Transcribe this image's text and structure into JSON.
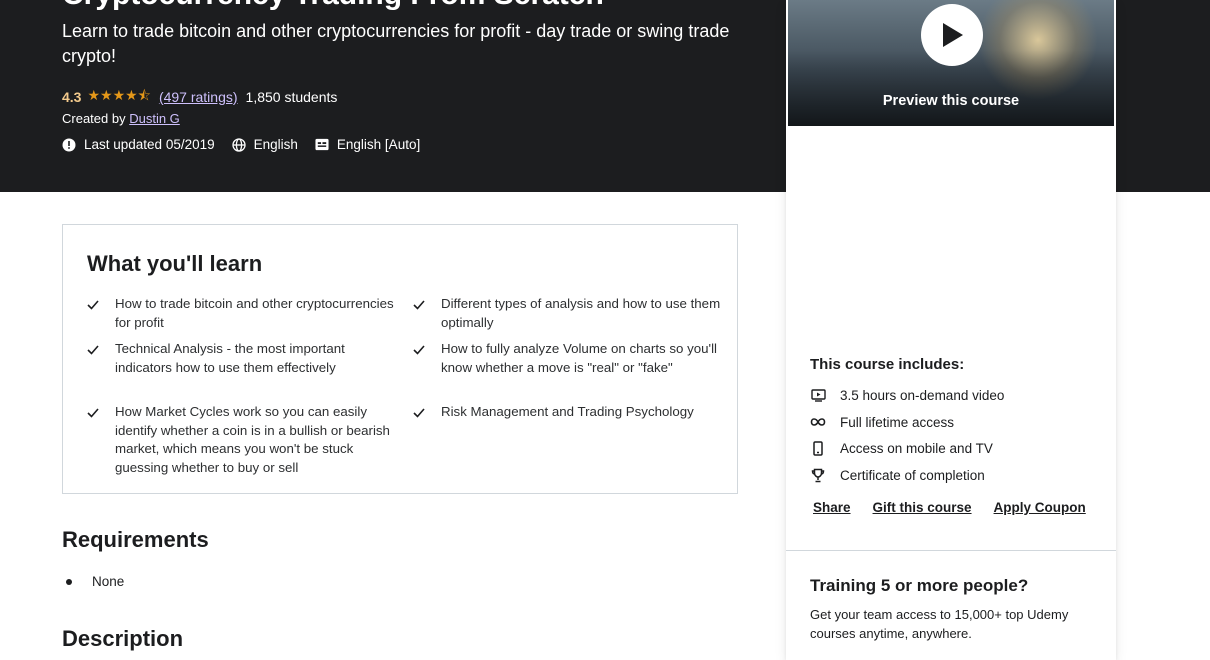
{
  "course": {
    "title": "Cryptocurrency Trading From Scratch",
    "subtitle": "Learn to trade bitcoin and other cryptocurrencies for profit - day trade or swing trade crypto!",
    "rating": "4.3",
    "stars": "★★★★⯪",
    "ratings_link": "(497 ratings)",
    "students": "1,850 students",
    "created_by_label": "Created by",
    "author": "Dustin G",
    "last_updated": "Last updated 05/2019",
    "language": "English",
    "captions": "English [Auto]"
  },
  "colors": {
    "hero_bg": "#1c1d1f",
    "rating": "#f3ca8c",
    "stars": "#e59819",
    "link": "#cec0fc"
  },
  "sidebar": {
    "preview_label": "Preview this course",
    "includes_title": "This course includes:",
    "includes": [
      {
        "icon": "video-icon",
        "label": "3.5 hours on-demand video"
      },
      {
        "icon": "infinity-icon",
        "label": "Full lifetime access"
      },
      {
        "icon": "mobile-icon",
        "label": "Access on mobile and TV"
      },
      {
        "icon": "trophy-icon",
        "label": "Certificate of completion"
      }
    ],
    "links": {
      "share": "Share",
      "gift": "Gift this course",
      "coupon": "Apply Coupon"
    },
    "team_title": "Training 5 or more people?",
    "team_text": "Get your team access to 15,000+ top Udemy courses anytime, anywhere."
  },
  "learn": {
    "title": "What you'll learn",
    "items": [
      "How to trade bitcoin and other cryptocurrencies for profit",
      "Different types of analysis and how to use them optimally",
      "Technical Analysis - the most important indicators how to use them effectively",
      "How to fully analyze Volume on charts so you'll know whether a move is \"real\" or \"fake\"",
      "How Market Cycles work so you can easily identify whether a coin is in a bullish or bearish market, which means you won't be stuck guessing whether to buy or sell",
      "Risk Management and Trading Psychology"
    ]
  },
  "requirements": {
    "title": "Requirements",
    "items": [
      "None"
    ]
  },
  "description": {
    "title": "Description"
  }
}
